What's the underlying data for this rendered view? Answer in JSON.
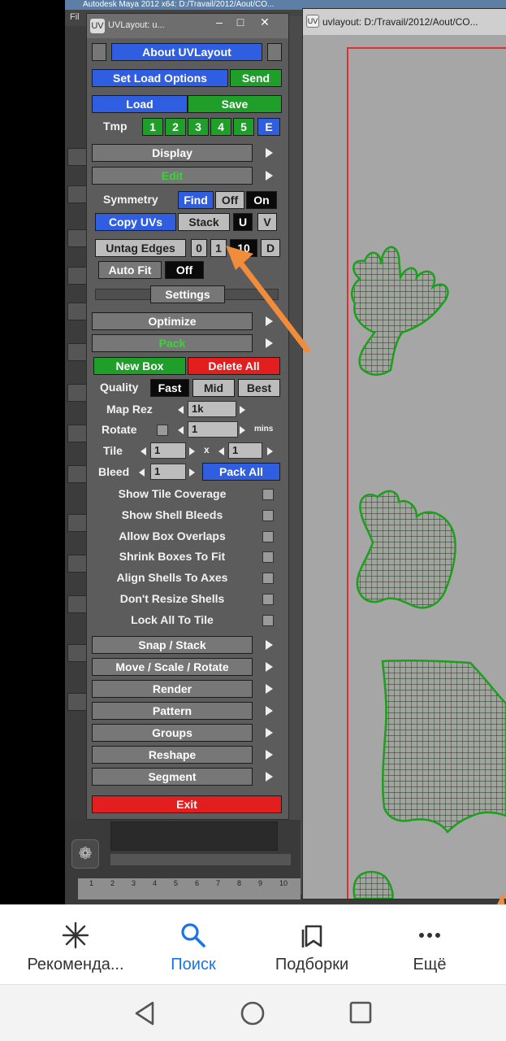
{
  "maya": {
    "title": "Autodesk Maya 2012 x64: D:/Travail/2012/Aout/CO...",
    "menu_first": "Fil",
    "ruler_ticks": [
      "1",
      "2",
      "3",
      "4",
      "5",
      "6",
      "7",
      "8",
      "9",
      "10"
    ]
  },
  "uv_panel": {
    "window_title": "UVLayout: u...",
    "about": "About UVLayout",
    "set_load_options": "Set Load Options",
    "send": "Send",
    "load": "Load",
    "save": "Save",
    "tmp_label": "Tmp",
    "tmp_slots": [
      "1",
      "2",
      "3",
      "4",
      "5",
      "E"
    ],
    "display": "Display",
    "edit": "Edit",
    "symmetry_label": "Symmetry",
    "find": "Find",
    "off": "Off",
    "on": "On",
    "copy_uvs": "Copy UVs",
    "stack": "Stack",
    "u": "U",
    "v": "V",
    "untag_edges": "Untag Edges",
    "edge_vals": [
      "0",
      "1",
      "10",
      "D"
    ],
    "auto_fit": "Auto Fit",
    "auto_fit_off": "Off",
    "settings": "Settings",
    "optimize": "Optimize",
    "pack": "Pack",
    "new_box": "New Box",
    "delete_all": "Delete All",
    "quality_label": "Quality",
    "quality_fast": "Fast",
    "quality_mid": "Mid",
    "quality_best": "Best",
    "map_rez_label": "Map Rez",
    "map_rez_value": "1k",
    "rotate_label": "Rotate",
    "rotate_value": "1",
    "rotate_unit": "mins",
    "tile_label": "Tile",
    "tile_x": "1",
    "tile_sep": "x",
    "tile_y": "1",
    "bleed_label": "Bleed",
    "bleed_value": "1",
    "pack_all": "Pack All",
    "options": [
      "Show Tile Coverage",
      "Show Shell Bleeds",
      "Allow Box Overlaps",
      "Shrink Boxes To Fit",
      "Align Shells To Axes",
      "Don't Resize Shells",
      "Lock All To Tile"
    ],
    "menus": [
      "Snap / Stack",
      "Move / Scale / Rotate",
      "Render",
      "Pattern",
      "Groups",
      "Reshape",
      "Segment"
    ],
    "exit": "Exit"
  },
  "viewport": {
    "title": "uvlayout: D:/Travail/2012/Aout/CO..."
  },
  "appbar": {
    "tabs": [
      {
        "label": "Рекоменда...",
        "icon": "asterisk-icon"
      },
      {
        "label": "Поиск",
        "icon": "search-icon"
      },
      {
        "label": "Подборки",
        "icon": "collections-icon"
      },
      {
        "label": "Ещё",
        "icon": "more-icon"
      }
    ],
    "active_color": "#1a73e8"
  }
}
